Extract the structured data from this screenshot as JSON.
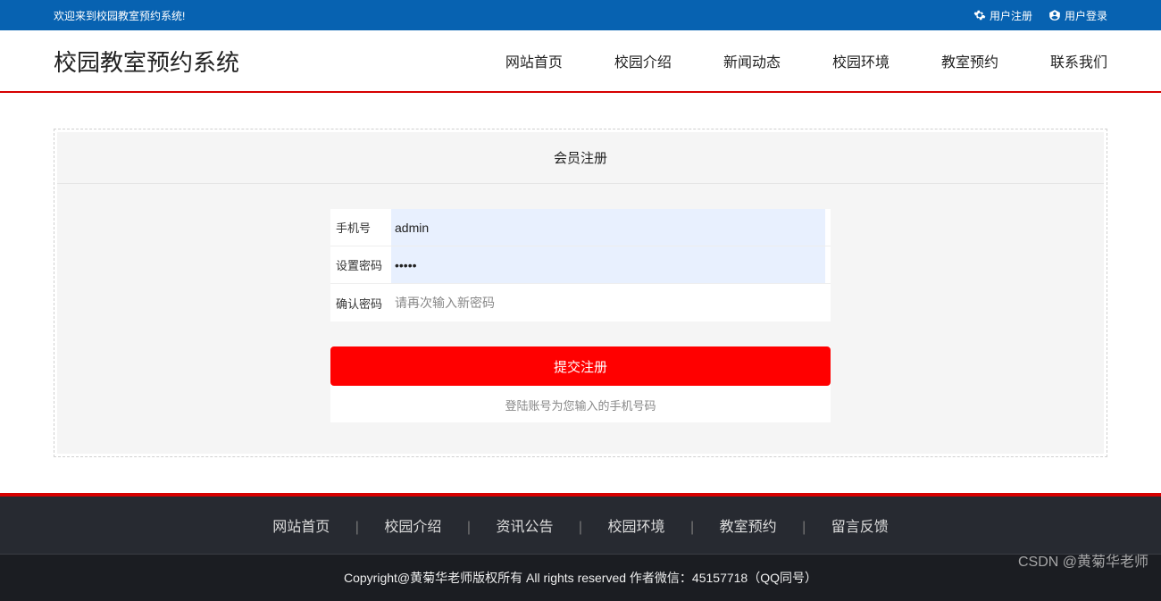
{
  "topbar": {
    "welcome": "欢迎来到校园教室预约系统!",
    "register": "用户注册",
    "login": "用户登录"
  },
  "header": {
    "logo": "校园教室预约系统",
    "nav": [
      "网站首页",
      "校园介绍",
      "新闻动态",
      "校园环境",
      "教室预约",
      "联系我们"
    ]
  },
  "form": {
    "title": "会员注册",
    "fields": {
      "phone": {
        "label": "手机号",
        "value": "admin"
      },
      "password": {
        "label": "设置密码",
        "value": "•••••"
      },
      "confirm": {
        "label": "确认密码",
        "placeholder": "请再次输入新密码"
      }
    },
    "submit": "提交注册",
    "hint": "登陆账号为您输入的手机号码"
  },
  "footer": {
    "nav": [
      "网站首页",
      "校园介绍",
      "资讯公告",
      "校园环境",
      "教室预约",
      "留言反馈"
    ],
    "copyright": "Copyright@黄菊华老师版权所有 All rights reserved 作者微信：45157718（QQ同号）"
  },
  "watermark": "CSDN @黄菊华老师"
}
